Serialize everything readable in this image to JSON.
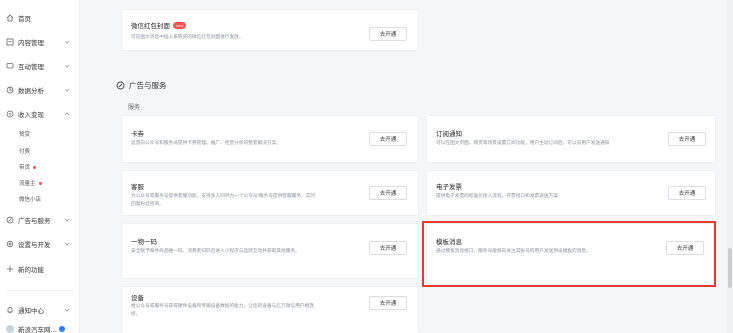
{
  "sidebar": {
    "items": [
      {
        "label": "首页",
        "icon": "home-icon"
      },
      {
        "label": "内容管理",
        "icon": "document-icon"
      },
      {
        "label": "互动管理",
        "icon": "chat-icon"
      },
      {
        "label": "数据分析",
        "icon": "chart-icon"
      },
      {
        "label": "收入变现",
        "icon": "money-icon"
      }
    ],
    "sub_items": [
      {
        "label": "赞赏"
      },
      {
        "label": "付费"
      },
      {
        "label": "带货"
      },
      {
        "label": "流量主"
      },
      {
        "label": "微信小店"
      }
    ],
    "bottom_items": [
      {
        "label": "广告与服务",
        "icon": "ads-icon"
      },
      {
        "label": "设置与开发",
        "icon": "settings-icon"
      },
      {
        "label": "新的功能",
        "icon": "plus-icon"
      }
    ],
    "footer": [
      {
        "label": "通知中心",
        "icon": "bell-icon"
      },
      {
        "label": "新浪汽车网…",
        "icon": "avatar"
      }
    ]
  },
  "main": {
    "top_card": {
      "title": "微信红包封面",
      "badge": "new",
      "desc": "可在图文消息中插入系购买的微信红包封面进行发放。",
      "button": "去开通"
    },
    "section_title": "广告与服务",
    "group_label": "服务",
    "cards": [
      {
        "title": "卡券",
        "desc": [
          "运营向公众号和服务号提供卡券管理、推广、经营分析的整套解决方案。"
        ],
        "button": "去开通"
      },
      {
        "title": "订阅通知",
        "desc": [
          "可以在图文页面、网页等场景设置订阅功能，用户主动订阅后，可以向用户发送通知"
        ],
        "button": "去开通"
      },
      {
        "title": "客服",
        "desc": [
          "为公众号或服务号提供客服功能，支持多人同时为一个公众号/服务号提供客服服务，实时",
          "回复粉丝咨询。"
        ],
        "button": "去开通"
      },
      {
        "title": "电子发票",
        "desc": [
          "提供电子发票的标准化接入流程，开票接口和发票递送方案"
        ],
        "button": "去开通"
      },
      {
        "title": "一物一码",
        "desc": [
          "安全赋予每件商品唯一码，消费者扫码后进入小程序与品牌互动并获取其他服务。"
        ],
        "button": "去开通"
      },
      {
        "title": "模板消息",
        "desc": [
          "通过模板消息接口，服务号能够向关注其账号的用户发送预设模板的消息。"
        ],
        "button": "去开通"
      },
      {
        "title": "设备",
        "desc": [
          "给公众号或服务号获得硬件设备和传输设备数据的能力，让您的设备与亿万微信用户相连",
          "接。"
        ],
        "button": "去开通"
      }
    ]
  }
}
